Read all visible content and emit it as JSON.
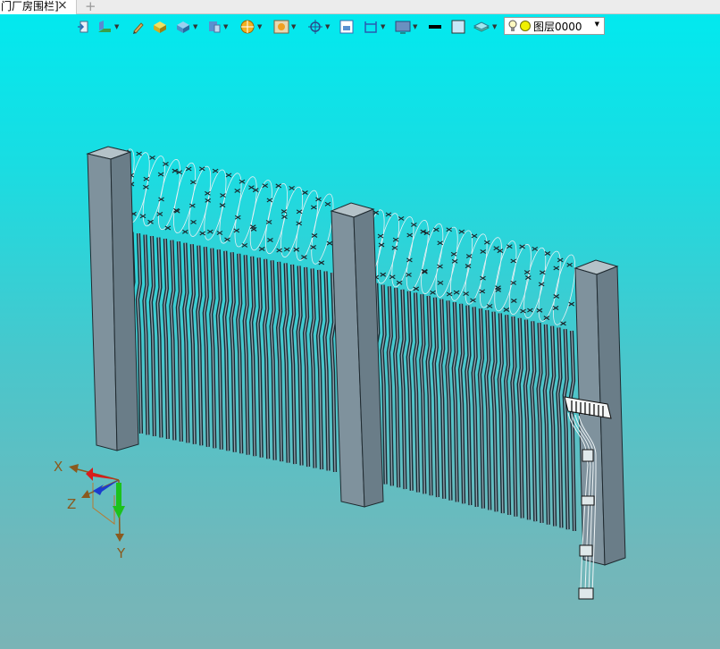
{
  "document_tab": {
    "title": "门厂房围栏]",
    "close_icon": "×",
    "add_icon": "+"
  },
  "toolbar": {
    "tools": [
      "exit-icon",
      "view-style-icon",
      "pencil-icon",
      "box-tool-icon",
      "solid-view-icon",
      "render-icon",
      "shading-icon",
      "display-icon",
      "snap-icon",
      "window-icon",
      "dimension-icon",
      "screen-icon",
      "line-color-icon",
      "fill-color-icon",
      "layer-stack-icon"
    ],
    "layer_selector": {
      "value": "图层0000"
    }
  },
  "triad": {
    "x_label": "X",
    "y_label": "Y",
    "z_label": "Z"
  },
  "colors": {
    "background_top": "#00eaf0",
    "background_bottom": "#7ab4b6",
    "post": "#7f929d",
    "axis_x": "#d81c1c",
    "axis_y": "#1cc21c",
    "axis_z": "#1a3ccf"
  }
}
